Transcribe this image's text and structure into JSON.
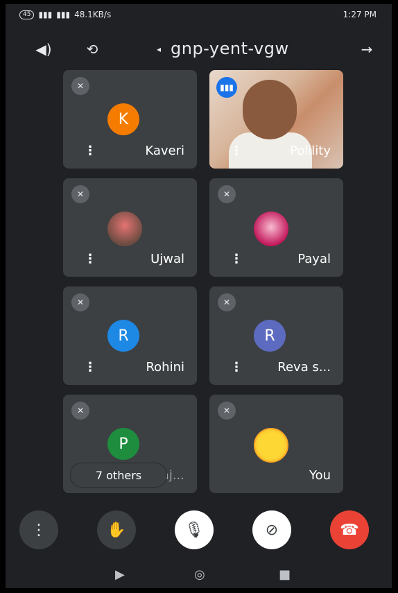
{
  "status": {
    "time": "1:27 PM",
    "speed": "48.1KB/s",
    "battery": "45"
  },
  "header": {
    "meeting_code": "gnp-yent-vgw",
    "back_icon": "arrow-back-icon",
    "camera_switch_icon": "switch-camera-icon",
    "audio_icon": "speaker-icon"
  },
  "tiles": [
    {
      "name": "Kaveri",
      "initial": "K",
      "color": "#f57c00"
    },
    {
      "name": "Polility"
    },
    {
      "name": "Ujwal"
    },
    {
      "name": "Payal"
    },
    {
      "name": "Rohini",
      "initial": "R",
      "color": "#1e88e5"
    },
    {
      "name": "Reva s...",
      "initial": "R",
      "color": "#5c6bc0"
    },
    {
      "name": "Praj...",
      "initial": "P",
      "color": "#1e8e3e",
      "others_label": "7 others"
    },
    {
      "name": "You"
    }
  ],
  "controls": {
    "more": "more-options-icon",
    "raise_hand": "raise-hand-icon",
    "mic": "mic-off-icon",
    "camera": "camera-off-icon",
    "hangup": "hang-up-icon",
    "hangup_color": "#ea4335"
  }
}
